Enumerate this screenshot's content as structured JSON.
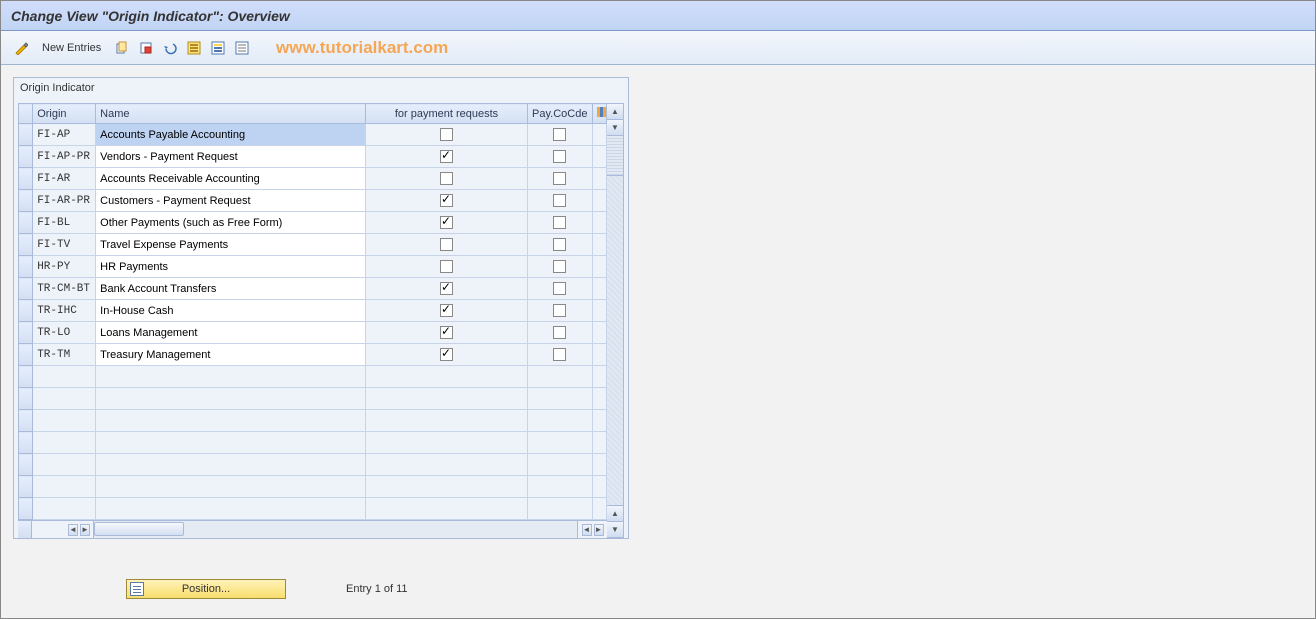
{
  "title": "Change View \"Origin Indicator\": Overview",
  "toolbar": {
    "new_entries": "New Entries"
  },
  "watermark": "www.tutorialkart.com",
  "panel": {
    "header": "Origin Indicator"
  },
  "columns": {
    "origin": "Origin",
    "name": "Name",
    "payreq": "for payment requests",
    "paycocde": "Pay.CoCde"
  },
  "rows": [
    {
      "origin": "FI-AP",
      "name": "Accounts Payable Accounting",
      "payreq": false,
      "paycocde": false,
      "selected": true
    },
    {
      "origin": "FI-AP-PR",
      "name": "Vendors - Payment Request",
      "payreq": true,
      "paycocde": false
    },
    {
      "origin": "FI-AR",
      "name": "Accounts Receivable Accounting",
      "payreq": false,
      "paycocde": false
    },
    {
      "origin": "FI-AR-PR",
      "name": "Customers - Payment Request",
      "payreq": true,
      "paycocde": false
    },
    {
      "origin": "FI-BL",
      "name": "Other Payments (such as Free Form)",
      "payreq": true,
      "paycocde": false
    },
    {
      "origin": "FI-TV",
      "name": "Travel Expense Payments",
      "payreq": false,
      "paycocde": false
    },
    {
      "origin": "HR-PY",
      "name": "HR Payments",
      "payreq": false,
      "paycocde": false
    },
    {
      "origin": "TR-CM-BT",
      "name": "Bank Account Transfers",
      "payreq": true,
      "paycocde": false
    },
    {
      "origin": "TR-IHC",
      "name": "In-House Cash",
      "payreq": true,
      "paycocde": false
    },
    {
      "origin": "TR-LO",
      "name": "Loans Management",
      "payreq": true,
      "paycocde": false
    },
    {
      "origin": "TR-TM",
      "name": "Treasury Management",
      "payreq": true,
      "paycocde": false
    }
  ],
  "empty_rows": 7,
  "footer": {
    "position_label": "Position...",
    "entry_text": "Entry 1 of 11"
  }
}
